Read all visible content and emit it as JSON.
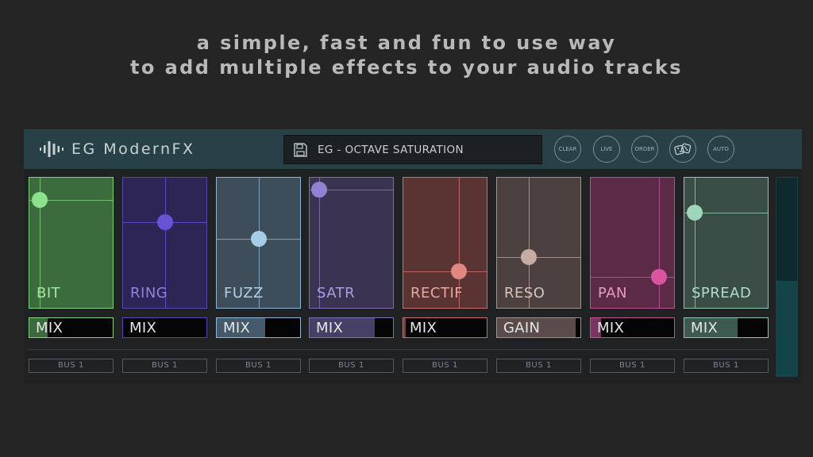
{
  "tagline": {
    "line1": "a simple, fast and fun to use way",
    "line2": "to add multiple effects to your audio tracks"
  },
  "header": {
    "logo_text": "EG ModernFX",
    "logo_icon": "waveform-icon",
    "preset_name": "EG - OCTAVE SATURATION",
    "preset_icon": "save-icon",
    "buttons": [
      {
        "label": "CLEAR"
      },
      {
        "label": "LIVE"
      },
      {
        "label": "ORDER"
      },
      {
        "label": "",
        "icon": "dice-icon"
      },
      {
        "label": "AUTO"
      }
    ]
  },
  "colors": {
    "background": "#252525",
    "header": "#274147",
    "panel": "#1f2123"
  },
  "effects": [
    {
      "name": "BIT",
      "control_label": "MIX",
      "bus": "BUS 1",
      "pad_x": 0.12,
      "pad_y": 0.17,
      "amount": 0.22,
      "bg": "#3c6b3e",
      "border": "#7fd27e",
      "line": "#6fbf6f",
      "knob": "#8fe08c",
      "label_color": "#a8e6a3",
      "fill": "#3c6b3e"
    },
    {
      "name": "RING",
      "control_label": "MIX",
      "bus": "BUS 1",
      "pad_x": 0.5,
      "pad_y": 0.34,
      "amount": 0.0,
      "bg": "#2c2555",
      "border": "#5547b5",
      "line": "#5a4cc0",
      "knob": "#6a52d6",
      "label_color": "#8f82dd",
      "fill": "#2c2555"
    },
    {
      "name": "FUZZ",
      "control_label": "MIX",
      "bus": "BUS 1",
      "pad_x": 0.5,
      "pad_y": 0.47,
      "amount": 0.58,
      "bg": "#3e4d5a",
      "border": "#8cb7d8",
      "line": "#7aa0bd",
      "knob": "#a5cde8",
      "label_color": "#b4cde0",
      "fill": "#44596a"
    },
    {
      "name": "SATR",
      "control_label": "MIX",
      "bus": "BUS 1",
      "pad_x": 0.11,
      "pad_y": 0.09,
      "amount": 0.78,
      "bg": "#3a3452",
      "border": "#7c6fb5",
      "line": "#7468ad",
      "knob": "#8f82d1",
      "label_color": "#a89edb",
      "fill": "#463f66"
    },
    {
      "name": "RECTIF",
      "control_label": "MIX",
      "bus": "BUS 1",
      "pad_x": 0.67,
      "pad_y": 0.72,
      "amount": 0.03,
      "bg": "#5a3433",
      "border": "#c7706b",
      "line": "#b8635e",
      "knob": "#e08781",
      "label_color": "#e3a8a3",
      "fill": "#7a3f3c"
    },
    {
      "name": "RESO",
      "control_label": "GAIN",
      "bus": "BUS 1",
      "pad_x": 0.38,
      "pad_y": 0.61,
      "amount": 0.94,
      "bg": "#4d4140",
      "border": "#a1928f",
      "line": "#a08f8a",
      "knob": "#c7aca2",
      "label_color": "#d4c3bd",
      "fill": "#5a4c4a"
    },
    {
      "name": "PAN",
      "control_label": "MIX",
      "bus": "BUS 1",
      "pad_x": 0.82,
      "pad_y": 0.76,
      "amount": 0.12,
      "bg": "#5a2a46",
      "border": "#c0508f",
      "line": "#b24b85",
      "knob": "#d9559f",
      "label_color": "#e49cc3",
      "fill": "#7a3460"
    },
    {
      "name": "SPREAD",
      "control_label": "MIX",
      "bus": "BUS 1",
      "pad_x": 0.12,
      "pad_y": 0.27,
      "amount": 0.64,
      "bg": "#3a4d47",
      "border": "#8cc6ad",
      "line": "#7fb59f",
      "knob": "#9fd6bb",
      "label_color": "#b2dcc8",
      "fill": "#3d5a50"
    }
  ],
  "output_meter": {
    "level": 0.48,
    "color": "#124448"
  }
}
